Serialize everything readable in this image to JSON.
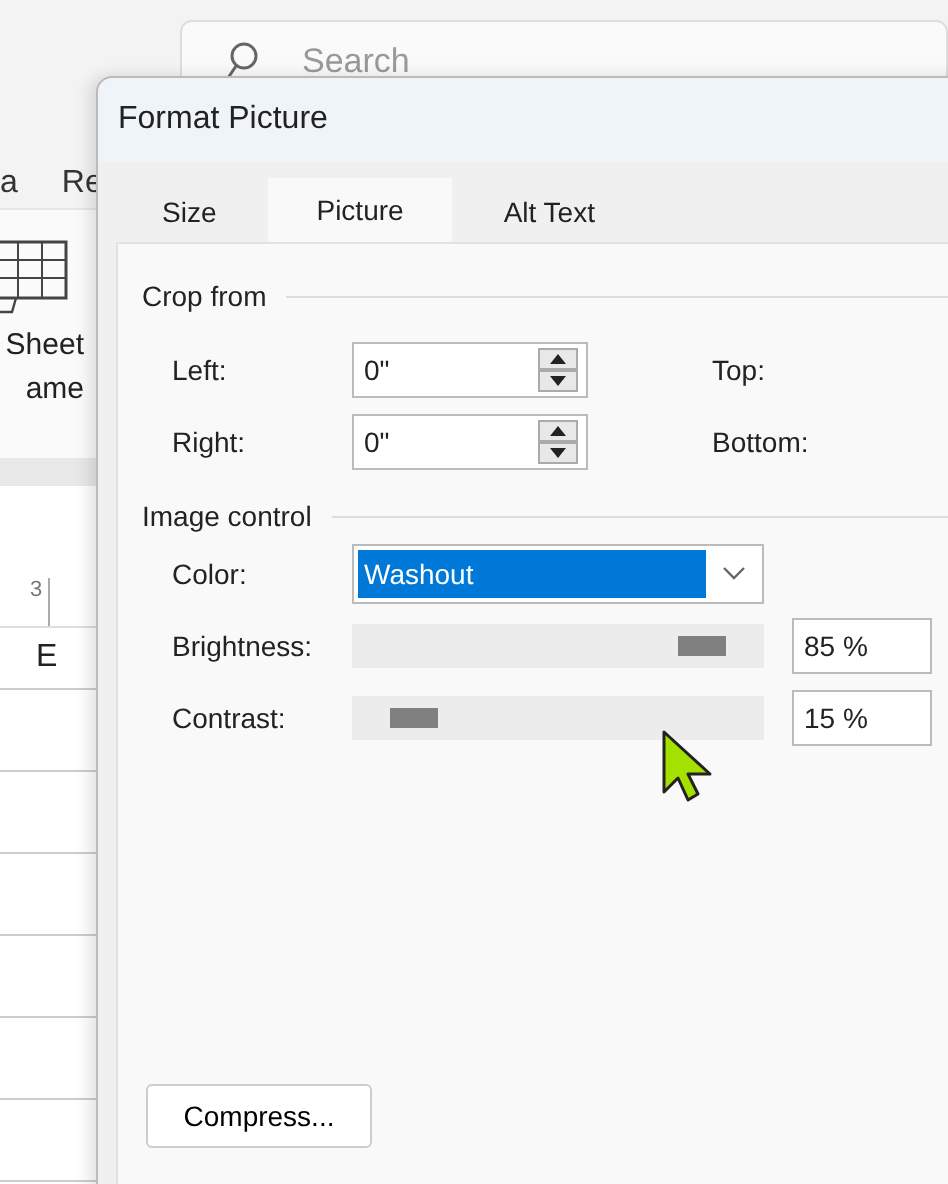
{
  "background_app": {
    "search": {
      "placeholder": "Search"
    },
    "ribbon_tabs": [
      "a",
      "Re"
    ],
    "ribbon_button_lines": [
      "Sheet",
      "ame"
    ],
    "ruler_mark": "3",
    "column_header": "E"
  },
  "dialog": {
    "title": "Format Picture",
    "tabs": [
      {
        "label": "Size",
        "selected": false
      },
      {
        "label": "Picture",
        "selected": true
      },
      {
        "label": "Alt Text",
        "selected": false
      }
    ],
    "crop_from": {
      "title": "Crop from",
      "rows": [
        {
          "label": "Left:",
          "value": "0\"",
          "side_label": "Top:"
        },
        {
          "label": "Right:",
          "value": "0\"",
          "side_label": "Bottom:"
        }
      ]
    },
    "image_control": {
      "title": "Image control",
      "color": {
        "label": "Color:",
        "value": "Washout"
      },
      "sliders": [
        {
          "label": "Brightness:",
          "level": 0.85,
          "reading": "85 %"
        },
        {
          "label": "Contrast:",
          "level": 0.15,
          "reading": "15 %"
        }
      ]
    },
    "compress_button": "Compress..."
  }
}
